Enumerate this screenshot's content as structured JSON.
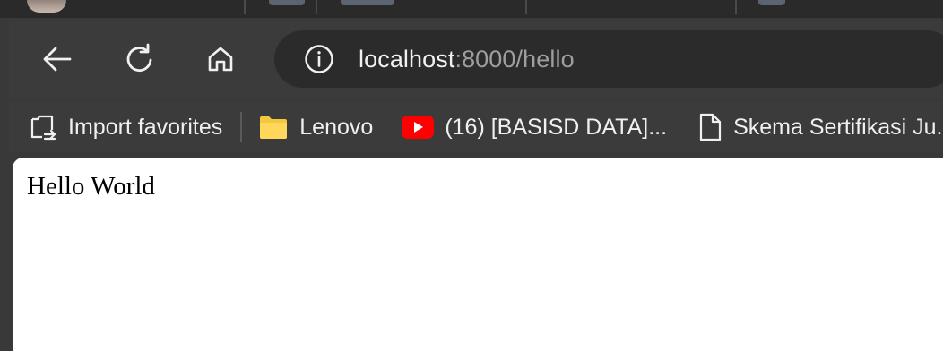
{
  "toolbar": {
    "back_icon": "arrow-left-icon",
    "reload_icon": "reload-icon",
    "home_icon": "home-icon"
  },
  "address_bar": {
    "info_icon": "info-icon",
    "host": "localhost",
    "rest": ":8000/hello"
  },
  "bookmarks": {
    "items": [
      {
        "label": "Import favorites",
        "icon": "import-favorites-icon"
      },
      {
        "label": "Lenovo",
        "icon": "folder-icon"
      },
      {
        "label": "(16) [BASISD DATA]...",
        "icon": "youtube-icon"
      },
      {
        "label": "Skema Sertifikasi Ju...",
        "icon": "document-icon"
      }
    ]
  },
  "colors": {
    "chrome_bg": "#3b3b3b",
    "address_bg": "#2b2b2b",
    "folder": "#f3c83e",
    "youtube": "#ff0000",
    "page_bg": "#ffffff"
  },
  "page": {
    "text": "Hello World"
  }
}
